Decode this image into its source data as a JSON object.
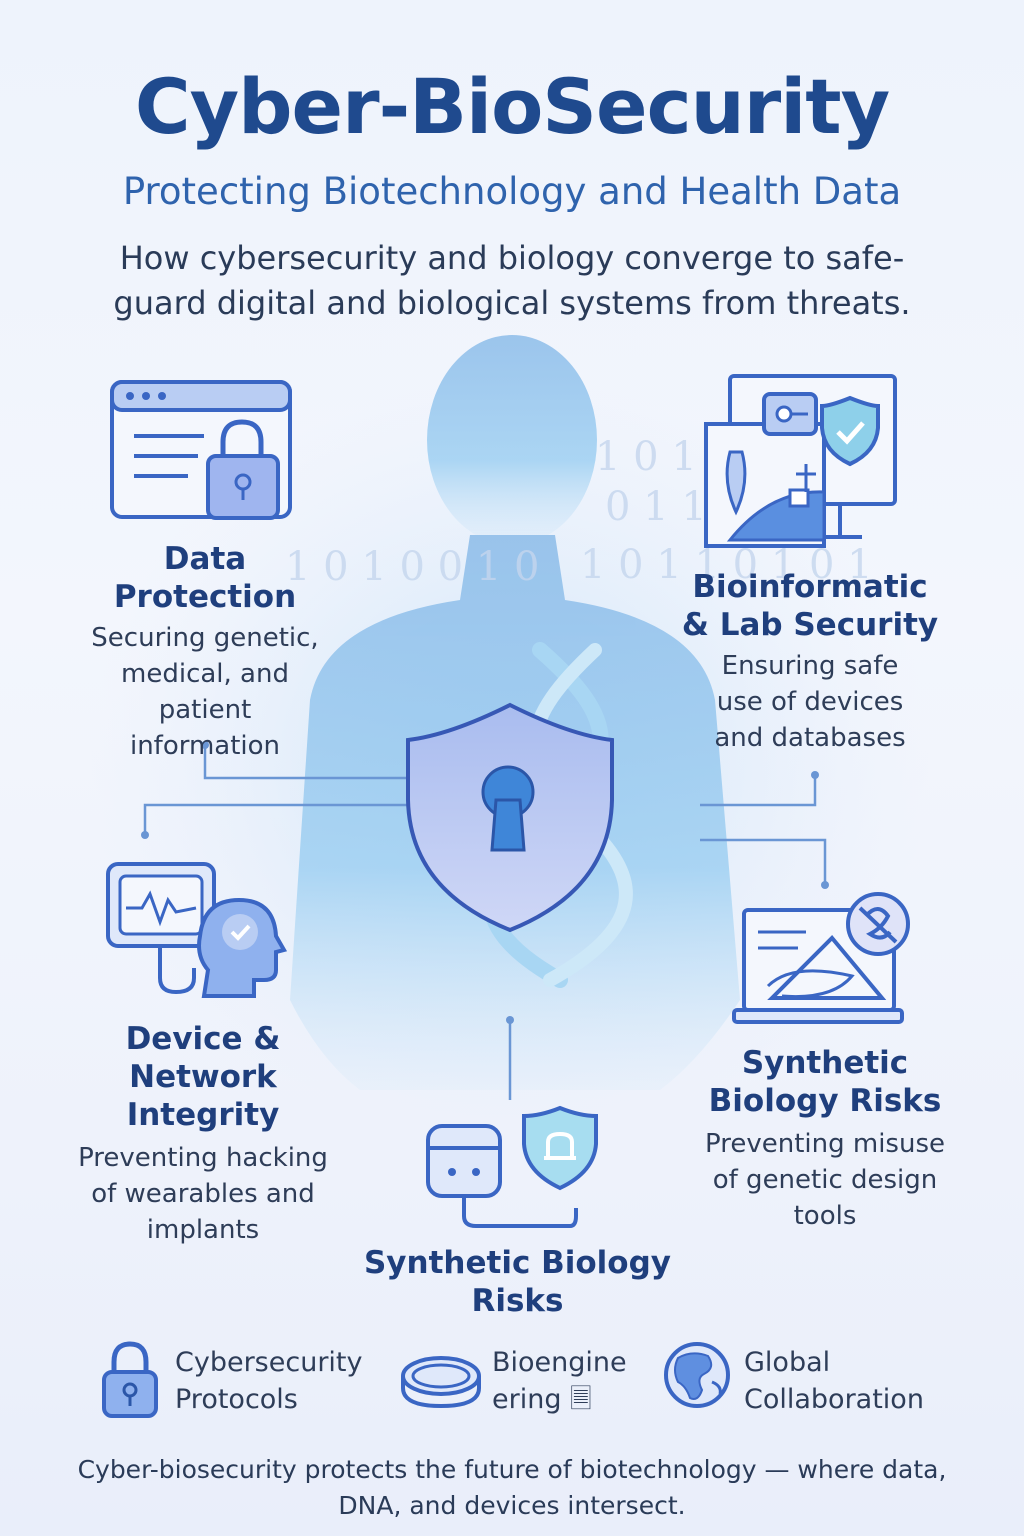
{
  "header": {
    "title": "Cyber-BioSecurity",
    "subtitle": "Protecting Biotechnology and Health Data",
    "intro_line1": "How cybersecurity and biology converge to safe-",
    "intro_line2": "guard digital and biological systems from threats."
  },
  "panels": {
    "data_protection": {
      "title_line1": "Data",
      "title_line2": "Protection",
      "desc_line1": "Securing genetic,",
      "desc_line2": "medical, and",
      "desc_line3": "patient information",
      "icon": "browser-lock-icon"
    },
    "bioinformatic": {
      "title_line1": "Bioinformatic",
      "title_line2": "& Lab Security",
      "desc_line1": "Ensuring safe",
      "desc_line2": "use of devices",
      "desc_line3": "and databases",
      "icon": "lab-monitor-icon"
    },
    "device_network": {
      "title_line1": "Device &",
      "title_line2": "Network Integrity",
      "desc_line1": "Preventing hacking",
      "desc_line2": "of wearables and",
      "desc_line3": "implants",
      "icon": "wearable-monitor-icon"
    },
    "synthetic_right": {
      "title_line1": "Synthetic",
      "title_line2": "Biology Risks",
      "desc_line1": "Preventing misuse",
      "desc_line2": "of genetic design",
      "desc_line3": "tools",
      "icon": "laptop-design-icon"
    },
    "synthetic_bottom": {
      "title_line1": "Synthetic Biology",
      "title_line2": "Risks",
      "icon": "device-shield-icon"
    }
  },
  "legend": [
    {
      "line1": "Cybersecurity",
      "line2": "Protocols",
      "icon": "padlock-icon"
    },
    {
      "line1": "Bioengine",
      "line2": "ering 🗏",
      "icon": "petri-dish-icon"
    },
    {
      "line1": "Global",
      "line2": "Collaboration",
      "icon": "globe-icon"
    }
  ],
  "footer": {
    "line1": "Cyber-biosecurity protects the future of biotechnology — where data,",
    "line2": "DNA, and devices intersect."
  },
  "binary_rows": [
    "1 0 1 1 0 1",
    "0 1 1 0 1 0",
    "1 0 1 0 0 1 0",
    "1 0 1 1 0 1 0 1"
  ],
  "colors": {
    "title": "#1f4a8e",
    "subtitle": "#2f63ad",
    "icon_stroke": "#3a66c4",
    "silhouette": "#8fc0ec",
    "shield": "#b9c9f2"
  }
}
